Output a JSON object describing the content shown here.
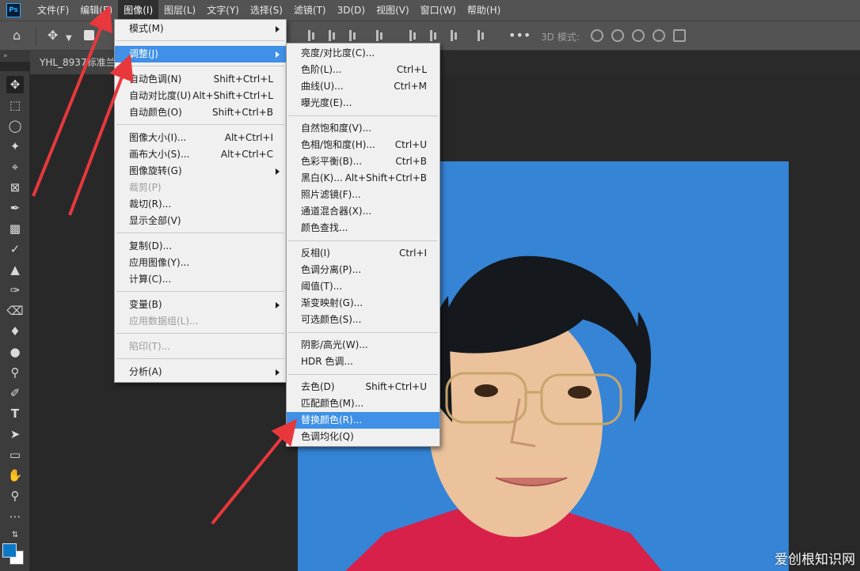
{
  "menubar": {
    "logo": "Ps",
    "items": [
      "文件(F)",
      "编辑(E)",
      "图像(I)",
      "图层(L)",
      "文字(Y)",
      "选择(S)",
      "滤镜(T)",
      "3D(D)",
      "视图(V)",
      "窗口(W)",
      "帮助(H)"
    ]
  },
  "options": {
    "mode3d_label": "3D 模式:"
  },
  "tab": {
    "title": "YHL_8937标准兰..."
  },
  "image_menu": {
    "items": [
      {
        "label": "模式(M)",
        "shortcut": "",
        "submenu": true
      },
      {
        "label": "调整(J)",
        "shortcut": "",
        "submenu": true,
        "highlighted": true
      },
      {
        "label": "自动色调(N)",
        "shortcut": "Shift+Ctrl+L"
      },
      {
        "label": "自动对比度(U)",
        "shortcut": "Alt+Shift+Ctrl+L"
      },
      {
        "label": "自动颜色(O)",
        "shortcut": "Shift+Ctrl+B"
      },
      {
        "label": "图像大小(I)...",
        "shortcut": "Alt+Ctrl+I"
      },
      {
        "label": "画布大小(S)...",
        "shortcut": "Alt+Ctrl+C"
      },
      {
        "label": "图像旋转(G)",
        "shortcut": "",
        "submenu": true
      },
      {
        "label": "裁剪(P)",
        "shortcut": "",
        "disabled": true
      },
      {
        "label": "裁切(R)...",
        "shortcut": ""
      },
      {
        "label": "显示全部(V)",
        "shortcut": ""
      },
      {
        "label": "复制(D)...",
        "shortcut": ""
      },
      {
        "label": "应用图像(Y)...",
        "shortcut": ""
      },
      {
        "label": "计算(C)...",
        "shortcut": ""
      },
      {
        "label": "变量(B)",
        "shortcut": "",
        "submenu": true
      },
      {
        "label": "应用数据组(L)...",
        "shortcut": "",
        "disabled": true
      },
      {
        "label": "陷印(T)...",
        "shortcut": "",
        "disabled": true
      },
      {
        "label": "分析(A)",
        "shortcut": "",
        "submenu": true
      }
    ]
  },
  "adjust_menu": {
    "items": [
      {
        "label": "亮度/对比度(C)...",
        "shortcut": ""
      },
      {
        "label": "色阶(L)...",
        "shortcut": "Ctrl+L"
      },
      {
        "label": "曲线(U)...",
        "shortcut": "Ctrl+M"
      },
      {
        "label": "曝光度(E)...",
        "shortcut": ""
      },
      {
        "label": "自然饱和度(V)...",
        "shortcut": ""
      },
      {
        "label": "色相/饱和度(H)...",
        "shortcut": "Ctrl+U"
      },
      {
        "label": "色彩平衡(B)...",
        "shortcut": "Ctrl+B"
      },
      {
        "label": "黑白(K)...",
        "shortcut": "Alt+Shift+Ctrl+B"
      },
      {
        "label": "照片滤镜(F)...",
        "shortcut": ""
      },
      {
        "label": "通道混合器(X)...",
        "shortcut": ""
      },
      {
        "label": "颜色查找...",
        "shortcut": ""
      },
      {
        "label": "反相(I)",
        "shortcut": "Ctrl+I"
      },
      {
        "label": "色调分离(P)...",
        "shortcut": ""
      },
      {
        "label": "阈值(T)...",
        "shortcut": ""
      },
      {
        "label": "渐变映射(G)...",
        "shortcut": ""
      },
      {
        "label": "可选颜色(S)...",
        "shortcut": ""
      },
      {
        "label": "阴影/高光(W)...",
        "shortcut": ""
      },
      {
        "label": "HDR 色调...",
        "shortcut": ""
      },
      {
        "label": "去色(D)",
        "shortcut": "Shift+Ctrl+U"
      },
      {
        "label": "匹配颜色(M)...",
        "shortcut": ""
      },
      {
        "label": "替换颜色(R)...",
        "shortcut": "",
        "highlighted": true
      },
      {
        "label": "色调均化(Q)",
        "shortcut": ""
      }
    ]
  },
  "colors": {
    "accent": "#3f90e6",
    "photo_bg": "#3584d6",
    "arrow": "#e8383d",
    "foreground": "#0e78c8",
    "background": "#ffffff"
  },
  "watermark": "爱创根知识网"
}
